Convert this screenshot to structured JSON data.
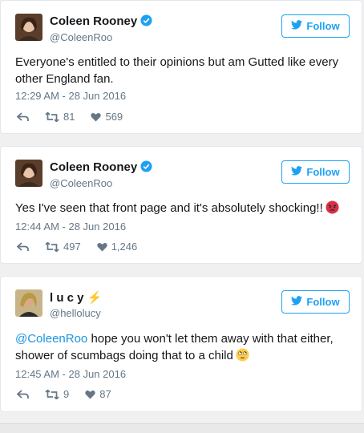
{
  "colors": {
    "accent": "#1da1f2",
    "text": "#14171a",
    "muted": "#657786"
  },
  "tweets": [
    {
      "name": "Coleen Rooney",
      "handle": "@ColeenRoo",
      "verified": true,
      "follow_label": "Follow",
      "text": "Everyone's entitled to their opinions but am Gutted like every other England fan.",
      "time": "12:29 AM - 28 Jun 2016",
      "retweets": "81",
      "likes": "569"
    },
    {
      "name": "Coleen Rooney",
      "handle": "@ColeenRoo",
      "verified": true,
      "follow_label": "Follow",
      "text": "Yes I've seen that front page and it's absolutely shocking!!",
      "emoji": "angry-face-emoji",
      "time": "12:44 AM - 28 Jun 2016",
      "retweets": "497",
      "likes": "1,246"
    },
    {
      "name": "l u c y ⚡",
      "handle": "@hellolucy",
      "verified": false,
      "follow_label": "Follow",
      "mention": "@ColeenRoo",
      "text": " hope you won't let them away with that either, shower of scumbags doing that to a child",
      "emoji": "face-with-rolling-eyes-emoji",
      "time": "12:45 AM - 28 Jun 2016",
      "retweets": "9",
      "likes": "87"
    }
  ]
}
